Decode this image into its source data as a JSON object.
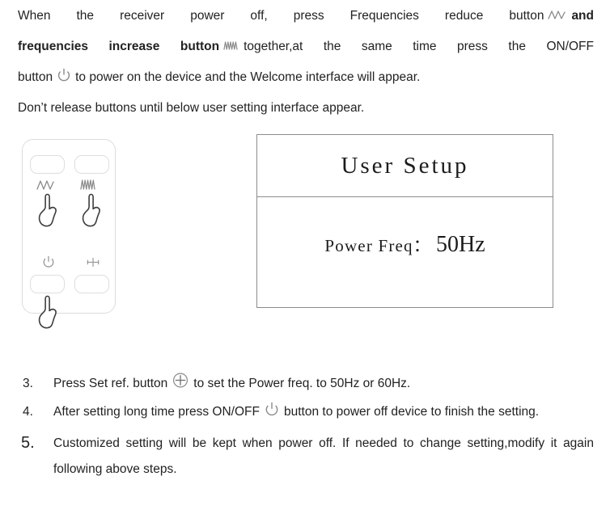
{
  "document": {
    "intro": {
      "line1_part1": "When the receiver power off, press Frequencies reduce button",
      "icon_freq_down": "wave-low-icon",
      "line1_part2": "and",
      "line2_part1": "frequencies increase button",
      "icon_freq_up": "wave-high-icon",
      "line2_part2": "together,at the same time press the ON/OFF",
      "line3_part1": "button",
      "icon_power": "power-icon",
      "line3_part2": "to power on the device and the Welcome interface will appear.",
      "line4": "Don’t release buttons until below user setting interface appear."
    },
    "device": {
      "label": "remote-control-illustration",
      "buttons": [
        {
          "name": "frequency-decrease-button",
          "icon": "wave-low-icon",
          "hand": true
        },
        {
          "name": "frequency-increase-button",
          "icon": "wave-high-icon",
          "hand": true
        },
        {
          "name": "power-on-off-button",
          "icon": "power-icon",
          "hand": true
        },
        {
          "name": "set-ref-button",
          "icon": "plus-ref-icon",
          "hand": false
        }
      ]
    },
    "lcd": {
      "title": "User Setup",
      "setting_label": "Power Freq：",
      "setting_value": "50Hz"
    },
    "steps": [
      {
        "number": "3.",
        "text_before": "Press Set ref. button",
        "icon": "circled-plus-icon",
        "text_after": "to set the Power freq. to 50Hz or 60Hz.",
        "big_number": false
      },
      {
        "number": "4.",
        "text_before": "After setting long time press ON/OFF",
        "icon": "power-icon",
        "text_after": "button to power off device to finish the setting.",
        "big_number": false
      },
      {
        "number": "5.",
        "text_before": "",
        "icon": "",
        "text_after": "Customized setting will be kept when power off. If needed to change setting,modify it again following above steps.",
        "big_number": true
      }
    ],
    "colors": {
      "text": "#222222",
      "lcd_border": "#8c8c8c",
      "device_border": "#dcdcdc",
      "icon_stroke": "#7a7a7a"
    }
  }
}
